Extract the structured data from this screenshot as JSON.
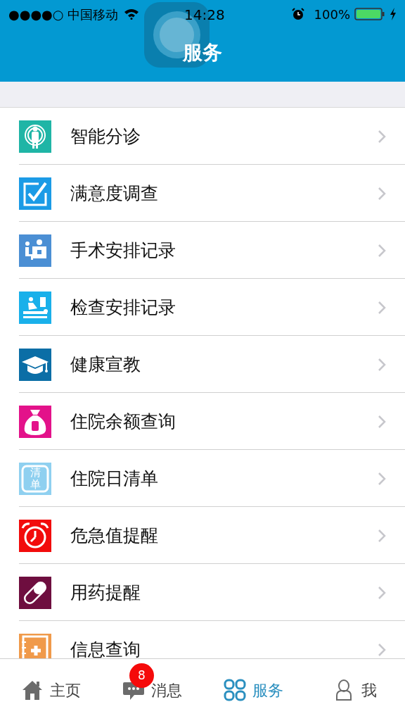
{
  "status_bar": {
    "carrier": "●●●●○ 中国移动",
    "time": "14:28",
    "battery": "100%"
  },
  "nav_bar": {
    "title": "服务"
  },
  "services": [
    {
      "kind": "person",
      "color": "#1fb5a6",
      "label": "智能分诊"
    },
    {
      "kind": "check",
      "color": "#1b9be6",
      "label": "满意度调查"
    },
    {
      "kind": "surgery",
      "color": "#4b8fd4",
      "label": "手术安排记录"
    },
    {
      "kind": "exam",
      "color": "#19b0ea",
      "label": "检查安排记录"
    },
    {
      "kind": "cap",
      "color": "#0b6ea6",
      "label": "健康宣教"
    },
    {
      "kind": "moneybag",
      "color": "#e3128a",
      "label": "住院余额查询"
    },
    {
      "kind": "list",
      "color": "#8fd0f0",
      "label": "住院日清单",
      "icon_text": "清单"
    },
    {
      "kind": "alarm",
      "color": "#f20c0c",
      "label": "危急值提醒"
    },
    {
      "kind": "pill",
      "color": "#6e0e3f",
      "label": "用药提醒"
    },
    {
      "kind": "record",
      "color": "#f09a4a",
      "label": "信息查询"
    }
  ],
  "tab_bar": [
    {
      "kind": "home",
      "label": "主页",
      "selected": false
    },
    {
      "kind": "chat",
      "label": "消息",
      "selected": false,
      "badge": "8"
    },
    {
      "kind": "grid",
      "label": "服务",
      "selected": true
    },
    {
      "kind": "user",
      "label": "我",
      "selected": false
    }
  ]
}
